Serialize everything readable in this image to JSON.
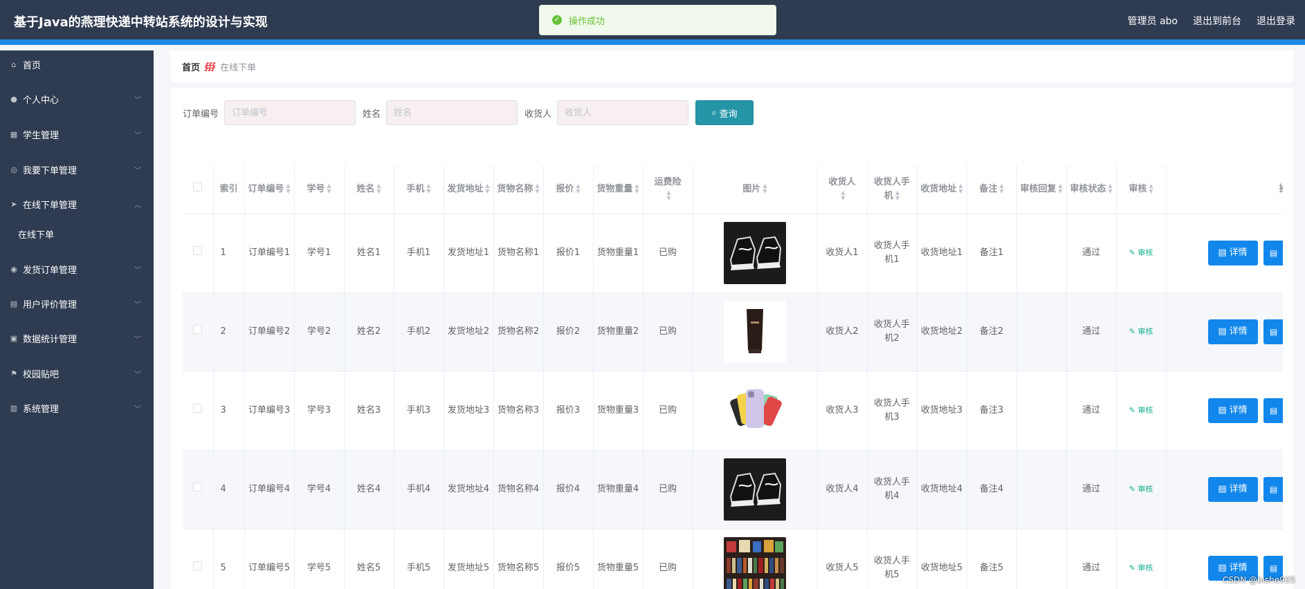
{
  "app": {
    "title": "基于Java的燕理快递中转站系统的设计与实现",
    "user_label": "管理员 abo",
    "back_frontend": "退出到前台",
    "logout": "退出登录"
  },
  "toast": {
    "message": "操作成功",
    "type": "success"
  },
  "sidebar": {
    "items": [
      {
        "label": "首页",
        "icon": "home-icon"
      },
      {
        "label": "个人中心",
        "icon": "user-icon"
      },
      {
        "label": "学生管理",
        "icon": "grid-icon"
      },
      {
        "label": "我要下单管理",
        "icon": "target-icon"
      },
      {
        "label": "在线下单管理",
        "icon": "send-icon",
        "expanded": true,
        "children": [
          {
            "label": "在线下单"
          }
        ]
      },
      {
        "label": "发货订单管理",
        "icon": "location-icon"
      },
      {
        "label": "用户评价管理",
        "icon": "clipboard-icon"
      },
      {
        "label": "数据统计管理",
        "icon": "briefcase-icon"
      },
      {
        "label": "校园贴吧",
        "icon": "flag-icon"
      },
      {
        "label": "系统管理",
        "icon": "chart-icon"
      }
    ]
  },
  "breadcrumb": {
    "home": "首页",
    "separator": "∰",
    "current": "在线下单"
  },
  "search": {
    "order_label": "订单编号",
    "order_placeholder": "订单编号",
    "name_label": "姓名",
    "name_placeholder": "姓名",
    "receiver_label": "收货人",
    "receiver_placeholder": "收货人",
    "query_button": "查询"
  },
  "table": {
    "headers": [
      "索引",
      "订单编号",
      "学号",
      "姓名",
      "手机",
      "发货地址",
      "货物名称",
      "报价",
      "货物重量",
      "运费险",
      "图片",
      "收货人",
      "收货人手机",
      "收货地址",
      "备注",
      "审核回复",
      "审核状态",
      "审核",
      "操作"
    ],
    "rows": [
      {
        "index": "1",
        "order_no": "订单编号1",
        "student_no": "学号1",
        "name": "姓名1",
        "phone": "手机1",
        "ship_addr": "发货地址1",
        "goods": "货物名称1",
        "quote": "报价1",
        "weight": "货物重量1",
        "insurance": "已购",
        "image": "sneakers",
        "receiver": "收货人1",
        "receiver_phone": "收货人手机1",
        "receive_addr": "收货地址1",
        "remark": "备注1",
        "reply": "",
        "status": "通过",
        "audit": "审核",
        "detail": "详情"
      },
      {
        "index": "2",
        "order_no": "订单编号2",
        "student_no": "学号2",
        "name": "姓名2",
        "phone": "手机2",
        "ship_addr": "发货地址2",
        "goods": "货物名称2",
        "quote": "报价2",
        "weight": "货物重量2",
        "insurance": "已购",
        "image": "tube",
        "receiver": "收货人2",
        "receiver_phone": "收货人手机2",
        "receive_addr": "收货地址2",
        "remark": "备注2",
        "reply": "",
        "status": "通过",
        "audit": "审核",
        "detail": "详情"
      },
      {
        "index": "3",
        "order_no": "订单编号3",
        "student_no": "学号3",
        "name": "姓名3",
        "phone": "手机3",
        "ship_addr": "发货地址3",
        "goods": "货物名称3",
        "quote": "报价3",
        "weight": "货物重量3",
        "insurance": "已购",
        "image": "phones",
        "receiver": "收货人3",
        "receiver_phone": "收货人手机3",
        "receive_addr": "收货地址3",
        "remark": "备注3",
        "reply": "",
        "status": "通过",
        "audit": "审核",
        "detail": "详情"
      },
      {
        "index": "4",
        "order_no": "订单编号4",
        "student_no": "学号4",
        "name": "姓名4",
        "phone": "手机4",
        "ship_addr": "发货地址4",
        "goods": "货物名称4",
        "quote": "报价4",
        "weight": "货物重量4",
        "insurance": "已购",
        "image": "sneakers",
        "receiver": "收货人4",
        "receiver_phone": "收货人手机4",
        "receive_addr": "收货地址4",
        "remark": "备注4",
        "reply": "",
        "status": "通过",
        "audit": "审核",
        "detail": "详情"
      },
      {
        "index": "5",
        "order_no": "订单编号5",
        "student_no": "学号5",
        "name": "姓名5",
        "phone": "手机5",
        "ship_addr": "发货地址5",
        "goods": "货物名称5",
        "quote": "报价5",
        "weight": "货物重量5",
        "insurance": "已购",
        "image": "books",
        "receiver": "收货人5",
        "receiver_phone": "收货人手机5",
        "receive_addr": "收货地址5",
        "remark": "备注5",
        "reply": "",
        "status": "通过",
        "audit": "审核",
        "detail": "详情"
      }
    ]
  },
  "watermark": "CSDN @bishe905",
  "colors": {
    "sidebar": "#2f3b50",
    "accent": "#1e88e5",
    "query": "#2596a8",
    "detail": "#1287eb",
    "audit": "#13ae8d"
  }
}
